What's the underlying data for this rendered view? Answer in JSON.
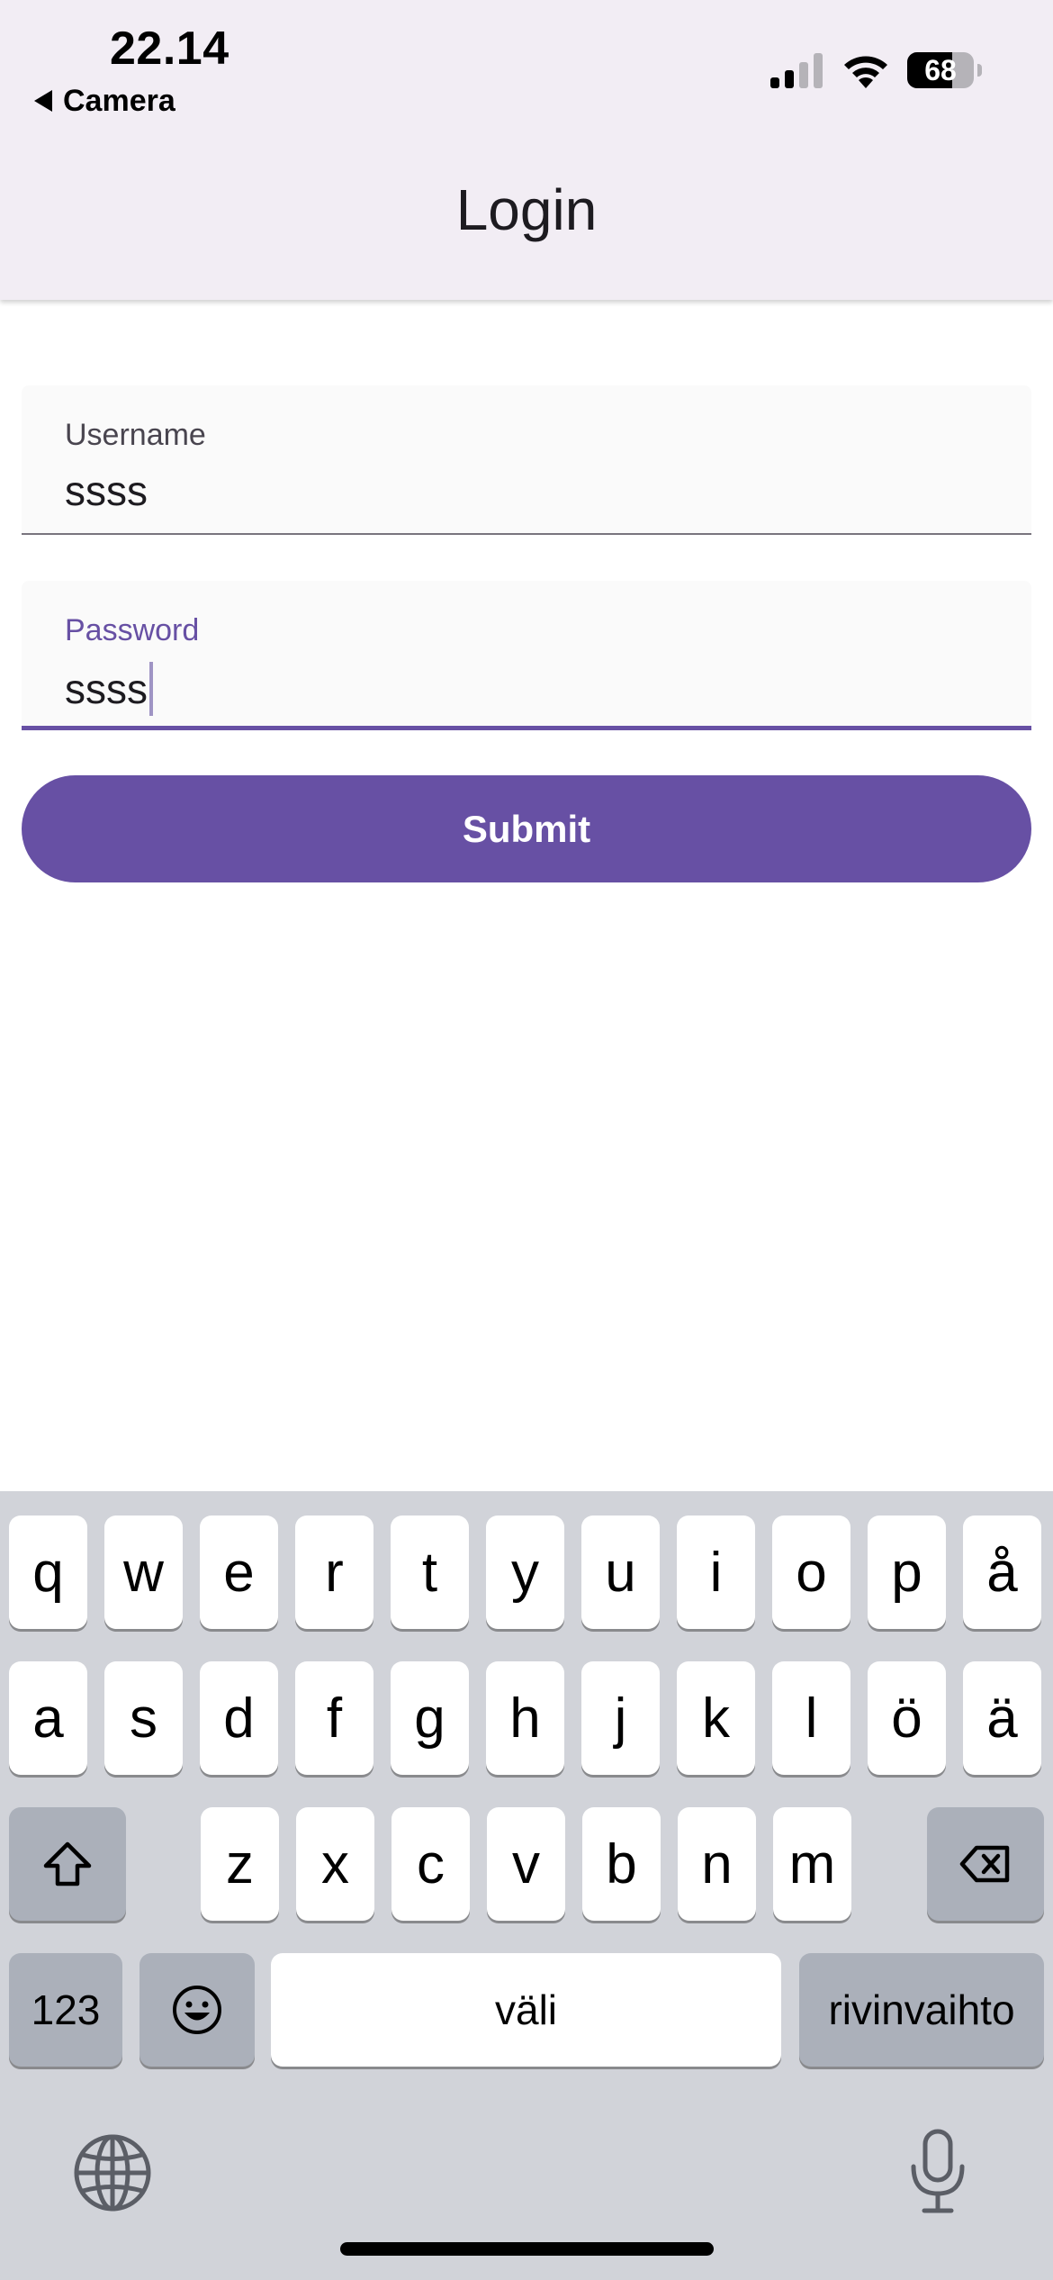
{
  "status_bar": {
    "time": "22.14",
    "back_app": "Camera",
    "battery_percent": "68",
    "battery_level": 0.68,
    "signal_bars": 2
  },
  "app_bar": {
    "title": "Login"
  },
  "form": {
    "username": {
      "label": "Username",
      "value": "ssss"
    },
    "password": {
      "label": "Password",
      "value": "ssss"
    },
    "submit_label": "Submit"
  },
  "keyboard": {
    "row1": [
      "q",
      "w",
      "e",
      "r",
      "t",
      "y",
      "u",
      "i",
      "o",
      "p",
      "å"
    ],
    "row2": [
      "a",
      "s",
      "d",
      "f",
      "g",
      "h",
      "j",
      "k",
      "l",
      "ö",
      "ä"
    ],
    "row3": [
      "z",
      "x",
      "c",
      "v",
      "b",
      "n",
      "m"
    ],
    "numbers_label": "123",
    "space_label": "väli",
    "return_label": "rivinvaihto"
  },
  "colors": {
    "primary": "#6750a4",
    "app_bar_bg": "#f2edf4",
    "keyboard_bg": "#d1d3d9"
  }
}
